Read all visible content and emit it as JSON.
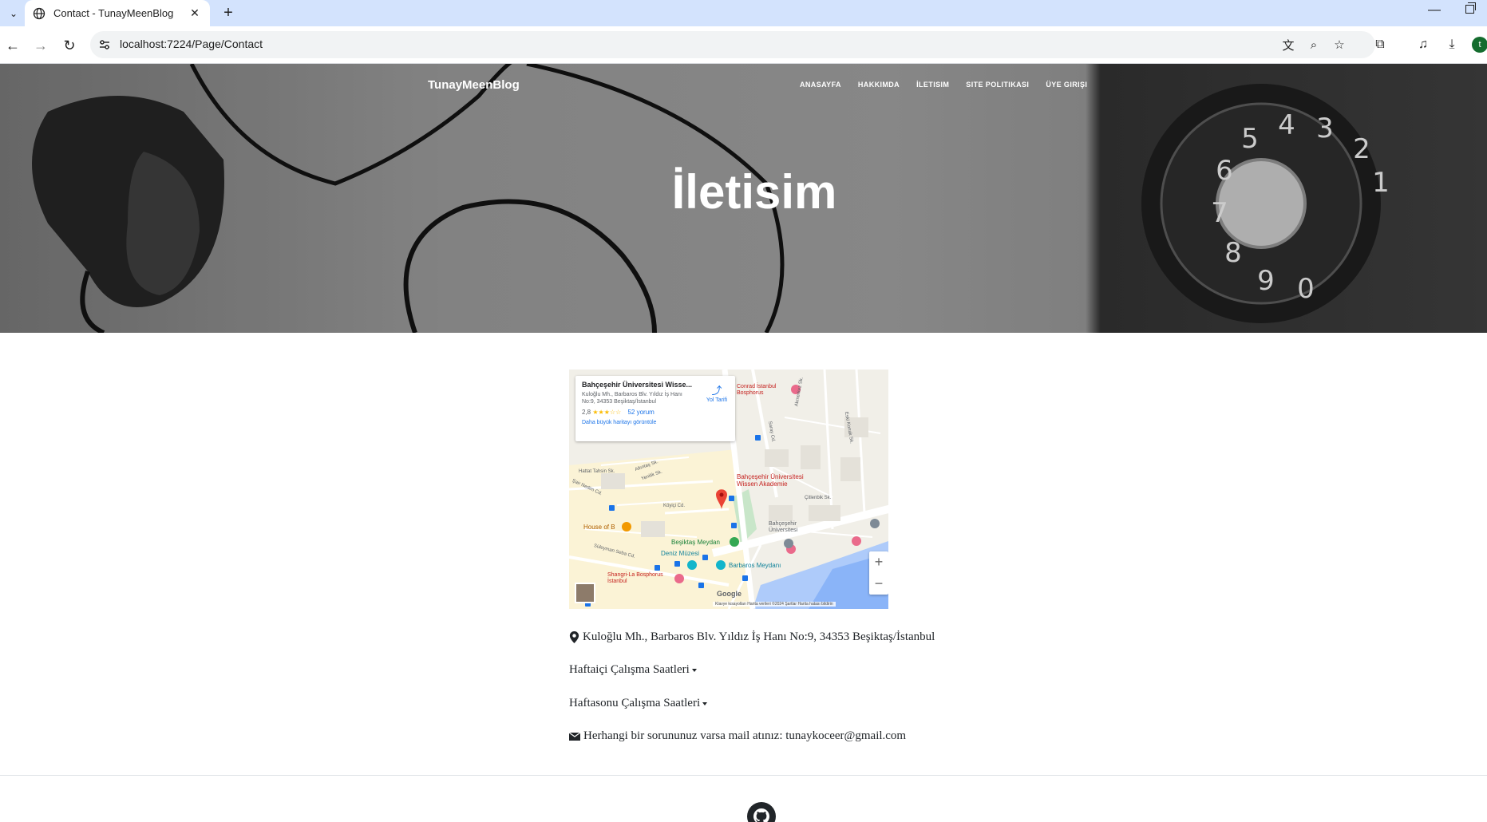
{
  "browser": {
    "tab_title": "Contact - TunayMeenBlog",
    "url": "localhost:7224/Page/Contact",
    "profile_initial": "t"
  },
  "site": {
    "brand": "TunayMeenBlog",
    "nav": [
      "ANASAYFA",
      "HAKKIMDA",
      "İLETISIM",
      "SITE POLITIKASI",
      "ÜYE GIRIŞI"
    ],
    "page_title": "İletisim"
  },
  "map": {
    "place_name": "Bahçeşehir Üniversitesi Wisse...",
    "place_address": "Kuloğlu Mh., Barbaros Blv. Yıldız İş Hanı No:9, 34353 Beşiktaş/İstanbul",
    "rating": "2,8",
    "reviews": "52 yorum",
    "directions": "Yol Tarifi",
    "bigger_map": "Daha büyük haritayı görüntüle",
    "marker_label_1": "Bahçeşehir Üniversitesi",
    "marker_label_2": "Wissen Akademie",
    "footer": "Klavye kısayolları   Harita verileri ©2024   Şartlar   Harita hatası bildirin",
    "google": "Google",
    "labels": {
      "conrad": "Conrad İstanbul Bosphorus",
      "besiktas_meydan": "Beşiktaş Meydan",
      "deniz_muzesi": "Deniz Müzesi",
      "barbaros_meydani": "Barbaros Meydanı",
      "shangri": "Shangri-La Bosphorus İstanbul",
      "house_of_b": "House of B",
      "bahcesehir_uni": "Bahçeşehir Üniversitesi",
      "koyici": "Köyiçi Cd.",
      "hattat": "Hattat Tahsin Sk.",
      "sair_nedim": "Şair Nedim Cd.",
      "suleyman": "Süleyman Seba Cd.",
      "cilenbik": "Çitlenbik Sk.",
      "saray": "Saray Cd.",
      "eski_konak": "Eski Konak Sk.",
      "akmerkez": "Akmerkez Sk.",
      "yenilik": "Yenilik Sk.",
      "altintas": "Altıntaş Sk."
    }
  },
  "contact": {
    "address": "Kuloğlu Mh., Barbaros Blv. Yıldız İş Hanı No:9, 34353 Beşiktaş/İstanbul",
    "weekday_hours": "Haftaiçi Çalışma Saatleri",
    "weekend_hours": "Haftasonu Çalışma Saatleri",
    "email_line": "Herhangi bir sorununuz varsa mail atınız: tunaykoceer@gmail.com"
  }
}
